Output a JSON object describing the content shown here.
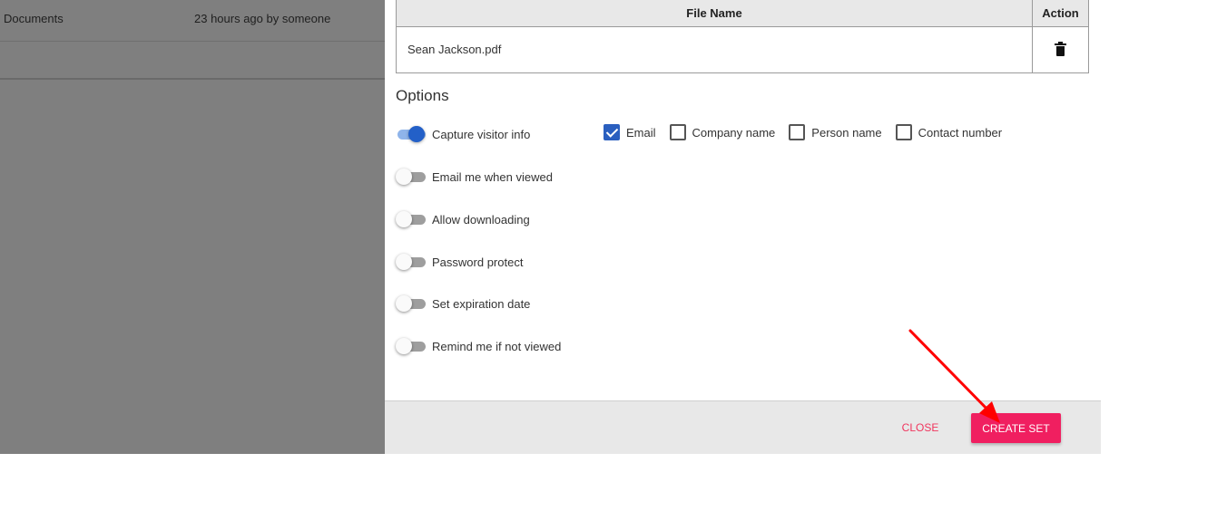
{
  "background": {
    "row_name": "Documents",
    "row_meta": "23 hours ago by someone"
  },
  "table": {
    "headers": [
      "File Name",
      "Action"
    ],
    "rows": [
      {
        "file_name": "Sean Jackson.pdf",
        "action_icon": "trash-icon"
      }
    ]
  },
  "options": {
    "title": "Options",
    "toggles": [
      {
        "label": "Capture visitor info",
        "on": true
      },
      {
        "label": "Email me when viewed",
        "on": false
      },
      {
        "label": "Allow downloading",
        "on": false
      },
      {
        "label": "Password protect",
        "on": false
      },
      {
        "label": "Set expiration date",
        "on": false
      },
      {
        "label": "Remind me if not viewed",
        "on": false
      }
    ],
    "visitor_fields": [
      {
        "label": "Email",
        "checked": true
      },
      {
        "label": "Company name",
        "checked": false
      },
      {
        "label": "Person name",
        "checked": false
      },
      {
        "label": "Contact number",
        "checked": false
      }
    ]
  },
  "footer": {
    "close_label": "CLOSE",
    "create_label": "CREATE SET"
  },
  "colors": {
    "accent": "#f01f60",
    "toggle_on": "#2360c8",
    "annotation_arrow": "#ff0000"
  }
}
